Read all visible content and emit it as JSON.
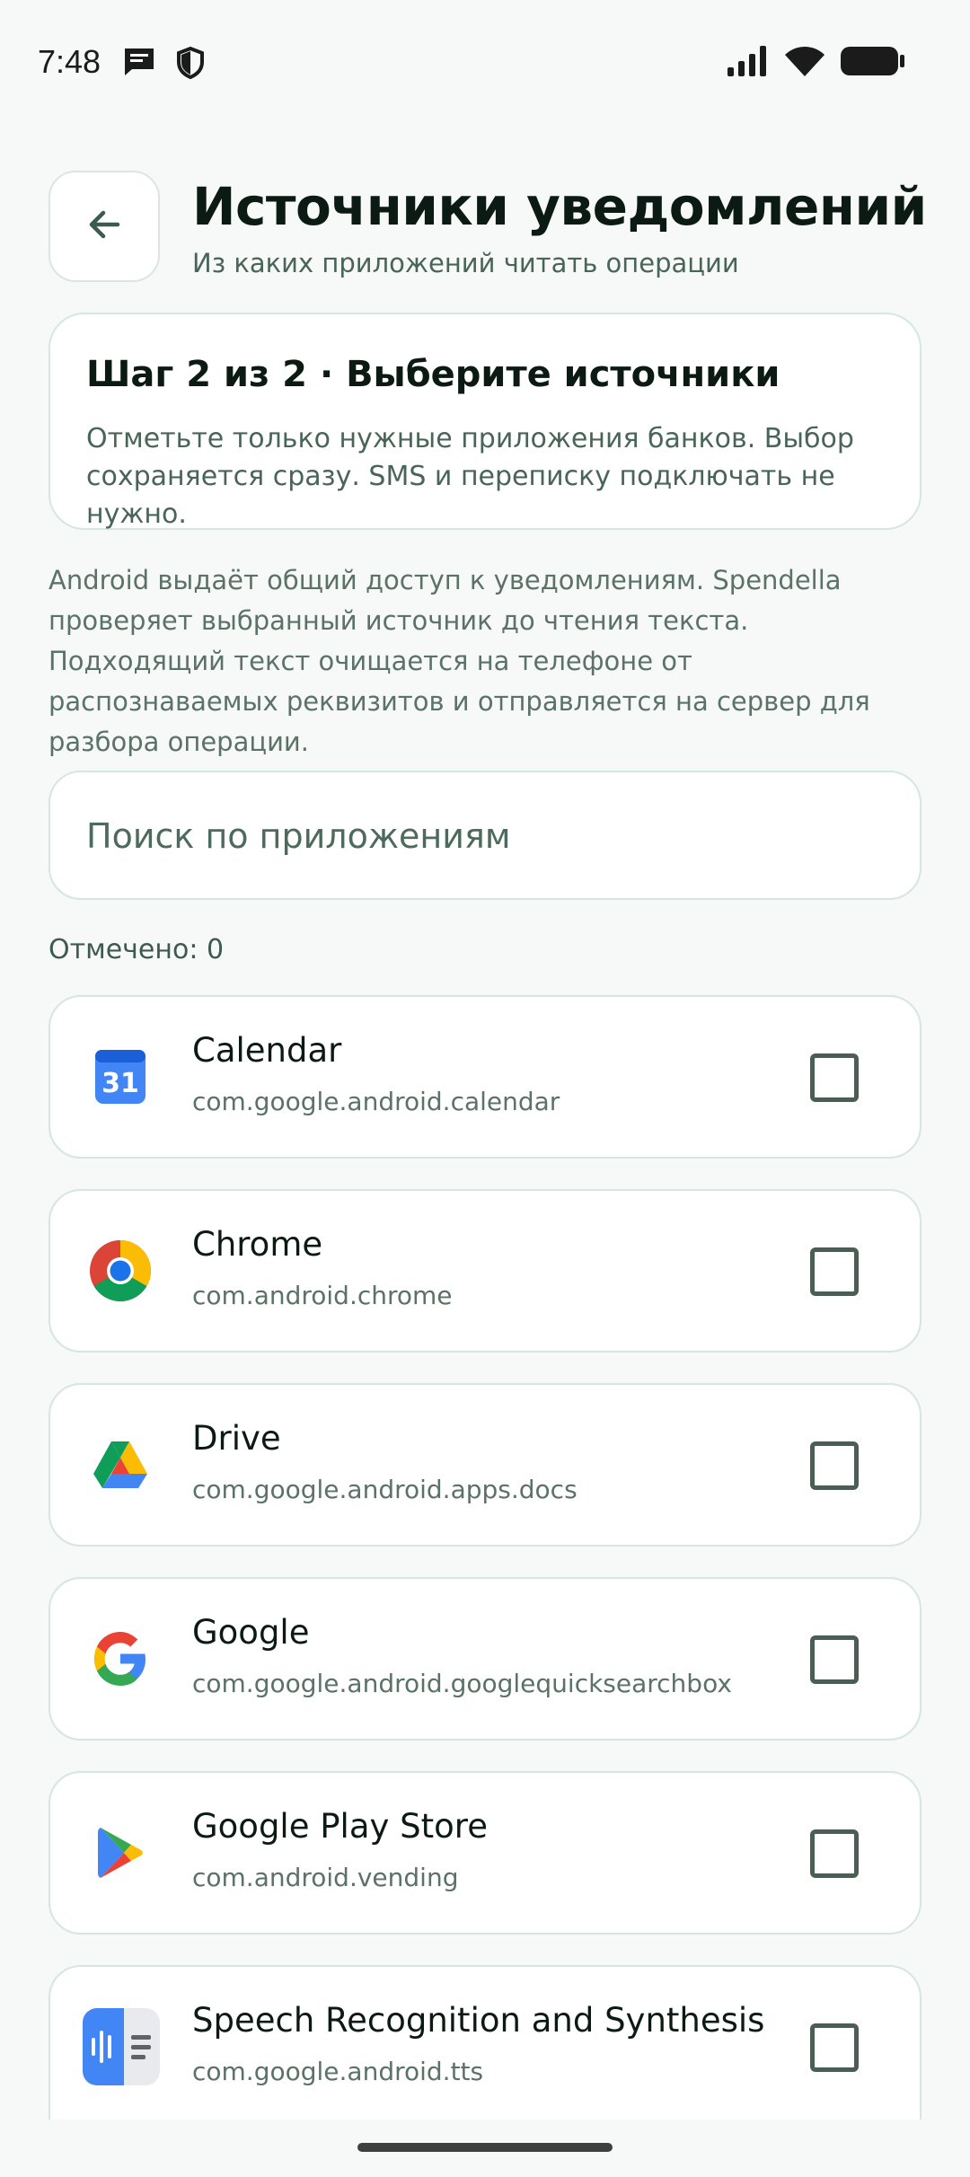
{
  "status_bar": {
    "time": "7:48",
    "icons": [
      "message-icon",
      "shield-icon",
      "signal-icon",
      "wifi-icon",
      "battery-icon"
    ]
  },
  "header": {
    "back_icon": "arrow-left-icon",
    "title": "Источники уведомлений",
    "subtitle": "Из каких приложений читать операции"
  },
  "step_card": {
    "title": "Шаг 2 из 2 · Выберите источники",
    "text": "Отметьте только нужные приложения банков. Выбор сохраняется сразу. SMS и переписку подключать не нужно."
  },
  "note": "Android выдаёт общий доступ к уведомлениям. Spendella проверяет выбранный источник до чтения текста. Подходящий текст очищается на телефоне от распознаваемых реквизитов и отправляется на сервер для разбора операции.",
  "search": {
    "placeholder": "Поиск по приложениям",
    "value": ""
  },
  "selected_count": "Отмечено: 0",
  "apps": [
    {
      "name": "Calendar",
      "package": "com.google.android.calendar",
      "icon": "calendar-icon",
      "checked": false
    },
    {
      "name": "Chrome",
      "package": "com.android.chrome",
      "icon": "chrome-icon",
      "checked": false
    },
    {
      "name": "Drive",
      "package": "com.google.android.apps.docs",
      "icon": "drive-icon",
      "checked": false
    },
    {
      "name": "Google",
      "package": "com.google.android.googlequicksearchbox",
      "icon": "google-icon",
      "checked": false
    },
    {
      "name": "Google Play Store",
      "package": "com.android.vending",
      "icon": "play-store-icon",
      "checked": false
    },
    {
      "name": "Speech Recognition and Synthesis",
      "package": "com.google.android.tts",
      "icon": "speech-synthesis-icon",
      "checked": false
    }
  ],
  "colors": {
    "background": "#f7f8f8",
    "card": "#ffffff",
    "border": "#d6e6e0",
    "text_primary": "#0c1a14",
    "text_secondary": "#496559"
  }
}
